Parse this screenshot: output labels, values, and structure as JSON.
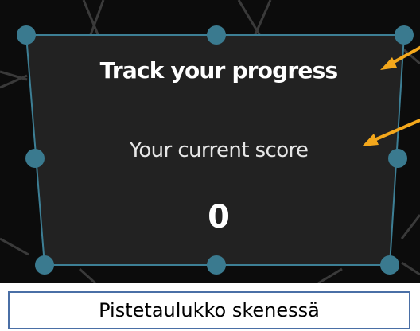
{
  "panel": {
    "title": "Track your progress",
    "subtitle": "Your current score",
    "score": "0"
  },
  "caption": "Pistetaulukko skenessä",
  "colors": {
    "panel_fill": "#222222",
    "panel_border": "#3d7f95",
    "handle": "#3a7a8f",
    "arrow": "#f4a81c",
    "background": "#0c0c0c",
    "caption_border": "#4a6fa6"
  },
  "icons": {
    "handle": "resize-handle-icon",
    "arrow": "annotation-arrow-icon"
  }
}
